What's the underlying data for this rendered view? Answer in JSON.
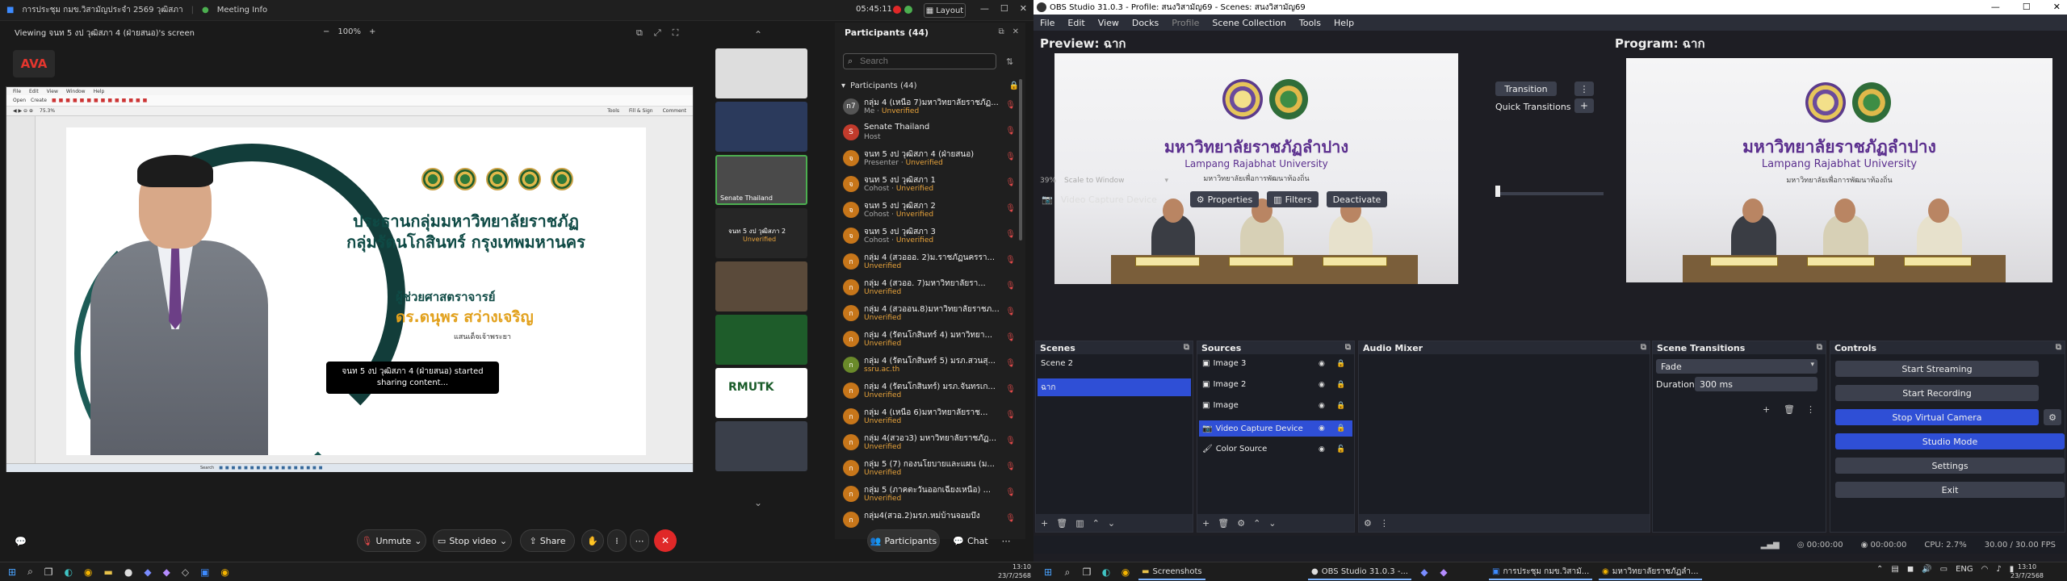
{
  "zoom": {
    "titlebar": {
      "meeting_title": "การประชุม กมข.วิสามัญประจำ 2569 วุฒิสภา",
      "meeting_info": "Meeting Info",
      "timer": "05:45:11",
      "layout_label": "Layout"
    },
    "share": {
      "viewing": "Viewing จนท 5 งป วุฒิสภา 4 (ฝ่ายสนอ)'s screen",
      "zoom_level": "100%",
      "logo_text": "AVA",
      "slide_title_1": "ประธานกลุ่มมหาวิทยาลัยราชภัฏ",
      "slide_title_2": "กลุ่มรัตนโกสินทร์ กรุงเทพมหานคร",
      "slide_sub_1": "ผู้ช่วยศาสตราจารย์",
      "slide_sub_2": "ดร.ดนุพร สว่างเจริญ",
      "slide_sub_3": "แสนเด็จเจ้าพระยา",
      "toast": "จนท 5 งป วุฒิสภา 4 (ฝ่ายสนอ) started sharing content...",
      "app_menu": [
        "File",
        "Edit",
        "View",
        "Window",
        "Help"
      ],
      "app_toolbar_open": "Open",
      "app_toolbar_create": "Create",
      "app_zoom": "75.3%",
      "app_tools": [
        "Tools",
        "Fill & Sign",
        "Comment"
      ],
      "app_search": "Search"
    },
    "thumbs": [
      {
        "label": ""
      },
      {
        "label": ""
      },
      {
        "label": "Senate Thailand"
      },
      {
        "label": "จนท 5 งป วุฒิสภา 2",
        "sub": "Unverified"
      },
      {
        "label": ""
      },
      {
        "label": ""
      },
      {
        "label": "RMUTK"
      },
      {
        "label": ""
      }
    ],
    "participants": {
      "header": "Participants (44)",
      "search_placeholder": "Search",
      "group_label": "Participants (44)",
      "rows": [
        {
          "initials": "n7",
          "name": "กลุ่ม 4 (เหนือ 7)มหาวิทยาลัยราชภัฏ...",
          "role": "Me",
          "status": "Unverified",
          "color": "#555"
        },
        {
          "initials": "S",
          "name": "Senate Thailand",
          "role": "Host",
          "status": "",
          "color": "#c23b2c"
        },
        {
          "initials": "จ",
          "name": "จนท 5 งป วุฒิสภา 4 (ฝ่ายสนอ)",
          "role": "Presenter",
          "status": "Unverified",
          "color": "#c7761a"
        },
        {
          "initials": "จ",
          "name": "จนท 5 งป วุฒิสภา 1",
          "role": "Cohost",
          "status": "Unverified",
          "color": "#c7761a"
        },
        {
          "initials": "จ",
          "name": "จนท 5 งป วุฒิสภา 2",
          "role": "Cohost",
          "status": "Unverified",
          "color": "#c7761a"
        },
        {
          "initials": "จ",
          "name": "จนท 5 งป วุฒิสภา 3",
          "role": "Cohost",
          "status": "Unverified",
          "color": "#c7761a"
        },
        {
          "initials": "ก",
          "name": "กลุ่ม 4 (สวอออ. 2)ม.ราชภัฏนครรา...",
          "role": "",
          "status": "Unverified",
          "color": "#c7761a"
        },
        {
          "initials": "ก",
          "name": "กลุ่ม 4 (สวออ. 7)มหาวิทยาลัยรา...",
          "role": "",
          "status": "Unverified",
          "color": "#c7761a"
        },
        {
          "initials": "ก",
          "name": "กลุ่ม 4 (สวออน.8)มหาวิทยาลัยราชภ...",
          "role": "",
          "status": "Unverified",
          "color": "#c7761a"
        },
        {
          "initials": "ก",
          "name": "กลุ่ม 4 (รัตนโกสินทร์ 4) มหาวิทยา...",
          "role": "",
          "status": "Unverified",
          "color": "#c7761a"
        },
        {
          "initials": "ก",
          "name": "กลุ่ม 4 (รัตนโกสินทร์ 5) มรภ.สวนสุ...",
          "role": "",
          "status": "ssru.ac.th",
          "color": "#6a8a2a"
        },
        {
          "initials": "ก",
          "name": "กลุ่ม 4 (รัตนโกสินทร์) มรภ.จันทรเก...",
          "role": "",
          "status": "Unverified",
          "color": "#c7761a"
        },
        {
          "initials": "ก",
          "name": "กลุ่ม 4 (เหนือ 6)มหาวิทยาลัยราช...",
          "role": "",
          "status": "Unverified",
          "color": "#c7761a"
        },
        {
          "initials": "ก",
          "name": "กลุ่ม 4(สวอว3) มหาวิทยาลัยราชภัฏ...",
          "role": "",
          "status": "Unverified",
          "color": "#c7761a"
        },
        {
          "initials": "ก",
          "name": "กลุ่ม 5 (7) กองนโยบายและแผน (ม...",
          "role": "",
          "status": "Unverified",
          "color": "#c7761a"
        },
        {
          "initials": "ก",
          "name": "กลุ่ม 5 (ภาคตะวันออกเฉียงเหนือ) ...",
          "role": "",
          "status": "Unverified",
          "color": "#c7761a"
        },
        {
          "initials": "ก",
          "name": "กลุ่ม4(สวอ.2)มรภ.หม่บ้านจอมบึง",
          "role": "",
          "status": "",
          "color": "#c7761a"
        }
      ]
    },
    "toolbar": {
      "unmute": "Unmute",
      "stop_video": "Stop video",
      "share": "Share",
      "participants": "Participants",
      "chat": "Chat"
    }
  },
  "obs": {
    "title": "OBS Studio 31.0.3 - Profile: สนงวิสามัญ69 - Scenes: สนงวิสามัญ69",
    "menu": [
      "File",
      "Edit",
      "View",
      "Docks",
      "Profile",
      "Scene Collection",
      "Tools",
      "Help"
    ],
    "preview_label": "Preview: ฉาก",
    "program_label": "Program: ฉาก",
    "video": {
      "thai_name": "มหาวิทยาลัยราชภัฏลำปาง",
      "eng_name": "Lampang Rajabhat University",
      "slogan": "มหาวิทยาลัยเพื่อการพัฒนาท้องถิ่น"
    },
    "transition_btn": "Transition",
    "quick_transitions": "Quick Transitions",
    "scale_percent": "39%",
    "scale_mode": "Scale to Window",
    "source_toolbar": {
      "selected_source": "Video Capture Device",
      "properties": "Properties",
      "filters": "Filters",
      "deactivate": "Deactivate"
    },
    "scenes": {
      "title": "Scenes",
      "items": [
        "Scene 2",
        "ฉาก"
      ],
      "selected": 1
    },
    "sources": {
      "title": "Sources",
      "items": [
        {
          "name": "Image 3",
          "icon": "image-icon"
        },
        {
          "name": "Image 2",
          "icon": "image-icon"
        },
        {
          "name": "Image",
          "icon": "image-icon"
        },
        {
          "name": "Video Capture Device",
          "icon": "camera-icon"
        },
        {
          "name": "Color Source",
          "icon": "brush-icon"
        }
      ],
      "selected": 3
    },
    "audio_mixer": {
      "title": "Audio Mixer"
    },
    "scene_transitions": {
      "title": "Scene Transitions",
      "type": "Fade",
      "duration_label": "Duration",
      "duration_value": "300 ms"
    },
    "controls": {
      "title": "Controls",
      "start_streaming": "Start Streaming",
      "start_recording": "Start Recording",
      "stop_virtual_camera": "Stop Virtual Camera",
      "studio_mode": "Studio Mode",
      "settings": "Settings",
      "exit": "Exit"
    },
    "status": {
      "time1": "00:00:00",
      "time2": "00:00:00",
      "cpu": "CPU: 2.7%",
      "fps": "30.00 / 30.00 FPS"
    }
  },
  "taskbar": {
    "left_clock_time": "13:10",
    "left_clock_date": "23/7/2568",
    "right_apps": [
      "Screenshots",
      "OBS Studio 31.0.3 -...",
      "การประชุม กมข.วิสามั...",
      "มหาวิทยาลัยราชภัฏลำ..."
    ],
    "tray_lang": "ENG",
    "right_clock_time": "13:10",
    "right_clock_date": "23/7/2568"
  },
  "colors": {
    "obs_accent": "#2f4fd6",
    "zoom_end": "#e02828",
    "unverified": "#e8a33b"
  }
}
